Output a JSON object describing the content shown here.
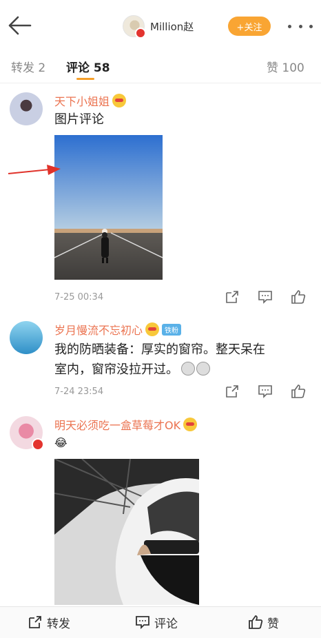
{
  "header": {
    "author_name": "Million赵",
    "follow_label": "+关注"
  },
  "tabs": [
    {
      "label": "转发 2"
    },
    {
      "label": "评论 58"
    },
    {
      "label": "赞 100"
    }
  ],
  "comments": [
    {
      "username": "天下小姐姐",
      "text": "图片评论",
      "time": "7-25 00:34"
    },
    {
      "username": "岁月慢流不忘初心",
      "badge": "铁粉",
      "text_line1": "我的防晒装备：厚实的窗帘。整天呆在",
      "text_line2": "室内，窗帘没拉开过。",
      "time": "7-24 23:54"
    },
    {
      "username": "明天必须吃一盒草莓才OK",
      "text": "😂"
    }
  ],
  "bottom_bar": {
    "repost_label": "转发",
    "comment_label": "评论",
    "like_label": "赞"
  },
  "colors": {
    "accent": "#f9a533",
    "username": "#eb7350"
  }
}
